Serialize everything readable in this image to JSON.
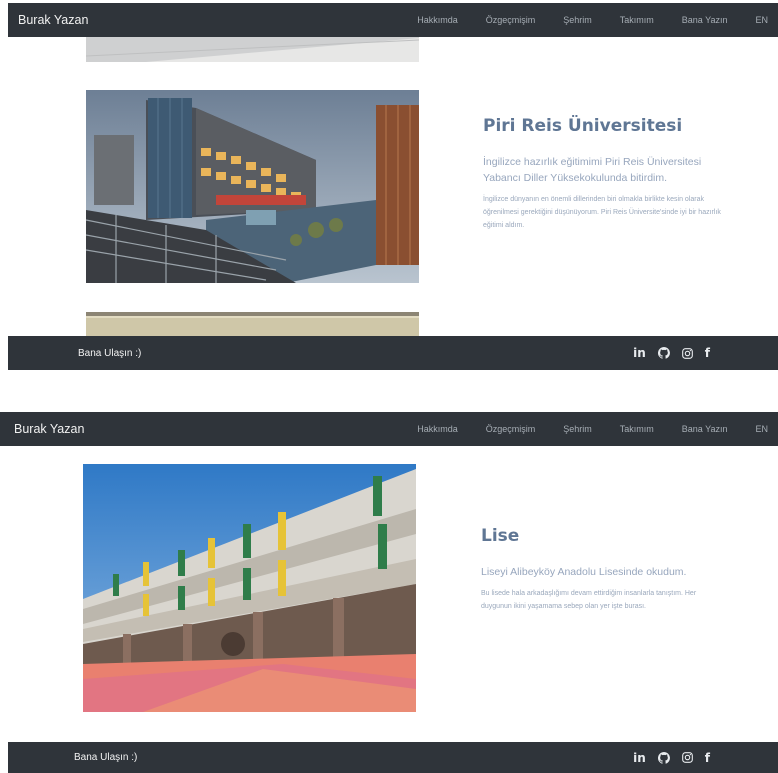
{
  "navbar": {
    "brand": "Burak Yazan",
    "links": [
      "Hakkımda",
      "Özgeçmişim",
      "Şehrim",
      "Takımım",
      "Bana Yazın",
      "EN"
    ]
  },
  "section1": {
    "title": "Piri Reis Üniversitesi",
    "lead": "İngilizce hazırlık eğitimimi Piri Reis Üniversitesi Yabancı Diller Yüksekokulunda bitirdim.",
    "body": "İngilizce dünyanın en önemli dillerinden biri olmakla birlikte kesin olarak öğrenilmesi gerektiğini düşünüyorum. Piri Reis Üniversite'sinde iyi bir hazırlık eğitimi aldım."
  },
  "section2": {
    "title": "Lise",
    "lead": "Liseyi Alibeyköy Anadolu Lisesinde okudum.",
    "body": "Bu lisede hala arkadaşlığımı devam ettirdiğim insanlarla tanıştım. Her duygunun ikini yaşamama sebep olan yer işte burası."
  },
  "footer": {
    "text": "Bana Ulaşın :)",
    "social_icons": [
      "linkedin-icon",
      "github-icon",
      "instagram-icon",
      "facebook-icon"
    ],
    "linkedin_label": "in",
    "facebook_label": "f"
  },
  "colors": {
    "navbar_bg": "#2f343a",
    "title": "#5f7694",
    "lead": "#97a6bd",
    "body": "#9aa8bc"
  }
}
